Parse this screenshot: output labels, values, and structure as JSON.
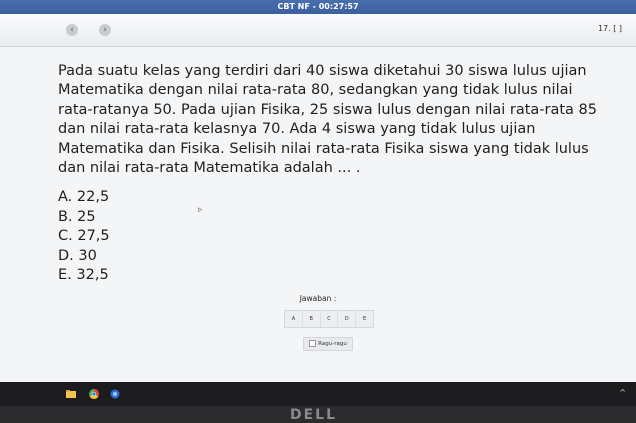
{
  "window": {
    "title": "CBT NF - 00:27:57"
  },
  "nav": {
    "prev_icon": "chevron-left-icon",
    "next_icon": "chevron-right-icon",
    "prev_glyph": "‹",
    "next_glyph": "›",
    "question_number": "17. [ ]"
  },
  "question": {
    "text": "Pada suatu kelas yang terdiri dari 40 siswa diketahui 30 siswa lulus ujian Matematika dengan nilai rata-rata 80, sedangkan yang tidak lulus nilai rata-ratanya 50. Pada ujian Fisika, 25 siswa lulus dengan nilai rata-rata 85 dan nilai rata-rata kelasnya 70. Ada 4 siswa yang tidak lulus ujian Matematika dan Fisika. Selisih nilai rata-rata Fisika siswa yang tidak lulus dan nilai rata-rata Matematika adalah ... .",
    "options": [
      "A. 22,5",
      "B. 25",
      "C. 27,5",
      "D. 30",
      "E. 32,5"
    ]
  },
  "answer": {
    "label": "Jawaban :",
    "choices": [
      "A",
      "B",
      "C",
      "D",
      "E"
    ],
    "doubt_label": "Ragu-ragu"
  },
  "taskbar": {
    "icons": [
      "folder-icon",
      "chrome-icon",
      "app-icon"
    ],
    "tray_icon": "chevron-up-icon"
  },
  "bezel": {
    "logo_text": "DELL"
  },
  "colors": {
    "title_bar": "#3c5f9e",
    "screen_bg": "#f4f5f7",
    "taskbar": "#1c1c1e"
  }
}
